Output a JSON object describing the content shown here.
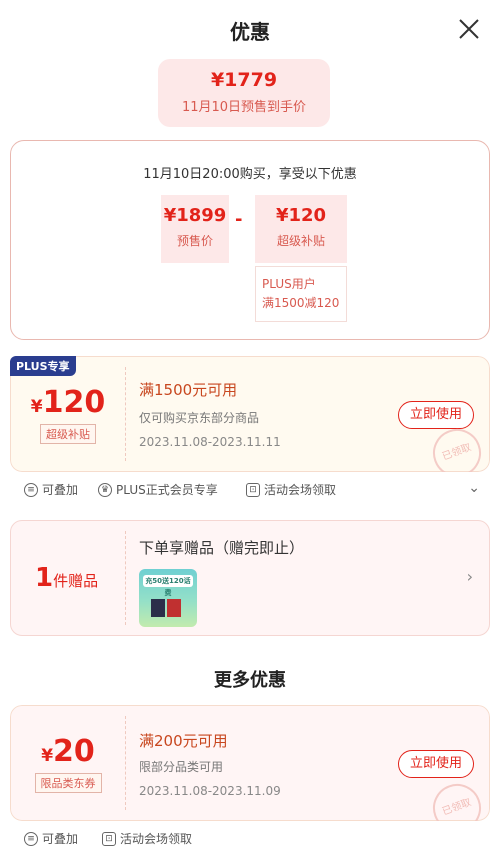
{
  "header": {
    "title": "优惠"
  },
  "presale": {
    "price": "¥1779",
    "label": "11月10日预售到手价"
  },
  "breakdown": {
    "intro": "11月10日20:00购买，享受以下优惠",
    "base": {
      "amount": "¥1899",
      "label": "预售价"
    },
    "minus": "-",
    "subsidy": {
      "amount": "¥120",
      "label": "超级补贴"
    },
    "note_line1": "PLUS用户",
    "note_line2": "满1500减120"
  },
  "coupon1": {
    "badge": "PLUS专享",
    "yen": "¥",
    "amount": "120",
    "tag": "超级补贴",
    "title": "满1500元可用",
    "desc": "仅可购买京东部分商品",
    "date": "2023.11.08-2023.11.11",
    "button": "立即使用",
    "stamp": "已领取",
    "features": [
      "可叠加",
      "PLUS正式会员专享",
      "活动会场领取"
    ]
  },
  "gift": {
    "count": "1",
    "count_label": "件赠品",
    "title": "下单享赠品（赠完即止）",
    "image_text": "充50送120话费"
  },
  "more": {
    "title": "更多优惠"
  },
  "coupon2": {
    "yen": "¥",
    "amount": "20",
    "tag": "限品类东券",
    "title": "满200元可用",
    "desc": "限部分品类可用",
    "date": "2023.11.08-2023.11.09",
    "button": "立即使用",
    "stamp": "已领取",
    "features": [
      "可叠加",
      "活动会场领取"
    ]
  },
  "colors": {
    "accent": "#e2231a",
    "plus_badge": "#2a3d8f",
    "coupon_bg": "#fffaf0",
    "coupon_bg2": "#fff5f5"
  }
}
